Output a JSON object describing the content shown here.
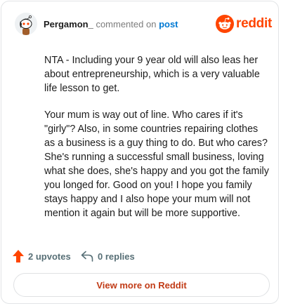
{
  "comment": {
    "username": "Pergamon_",
    "action_text": "commented on",
    "post_link_label": "post",
    "paragraphs": [
      "NTA - Including your 9 year old will also leas her about entrepreneurship, which is a very valuable life lesson to get.",
      "Your mum is way out of line. Who cares if it's \"girly\"? Also, in some countries repairing clothes as a business is a guy thing to do. But who cares? She's running a successful small business, loving what she does, she's happy and you got the family you longed for. Good on you! I hope you family stays happy and I also hope your mum will not mention it again but will be more supportive."
    ],
    "upvotes_label": "2 upvotes",
    "replies_label": "0 replies"
  },
  "brand": {
    "wordmark": "reddit",
    "color": "#ff4500",
    "icon": "reddit-logo-icon"
  },
  "footer": {
    "view_more_label": "View more on Reddit"
  },
  "icons": {
    "avatar": "snoo-avatar-icon",
    "upvote": "upvote-arrow-icon",
    "reply": "reply-arrow-icon"
  },
  "colors": {
    "upvote": "#ff4500",
    "link": "#0079d3",
    "view_more_text": "#c13b16"
  }
}
